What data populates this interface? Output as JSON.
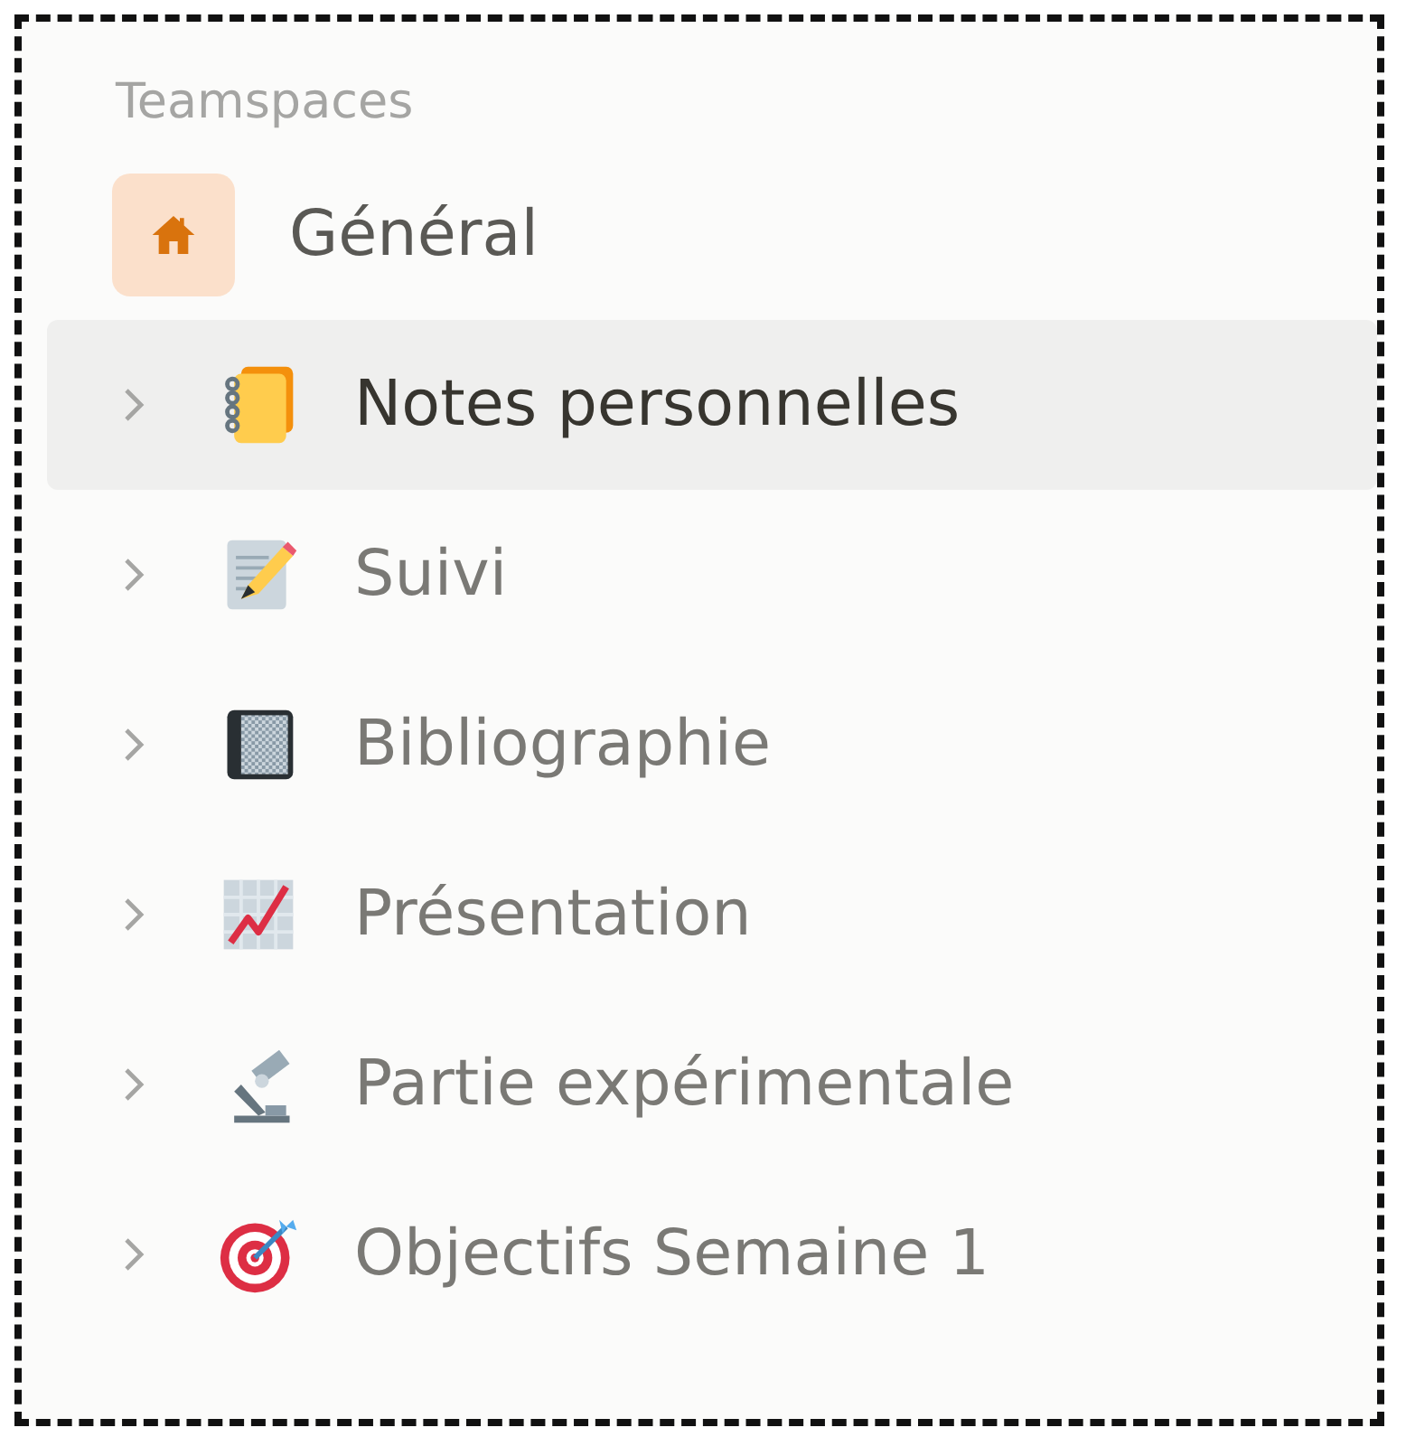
{
  "sidebar": {
    "heading": "Teamspaces",
    "teamspace": {
      "label": "Général"
    },
    "items": [
      {
        "label": "Notes personnelles",
        "selected": true,
        "expanded": false
      },
      {
        "label": "Suivi",
        "selected": false,
        "expanded": false
      },
      {
        "label": "Bibliographie",
        "selected": false,
        "expanded": false
      },
      {
        "label": "Présentation",
        "selected": false,
        "expanded": false
      },
      {
        "label": "Partie expérimentale",
        "selected": false,
        "expanded": false
      },
      {
        "label": "Objectifs Semaine 1",
        "selected": false,
        "expanded": false
      }
    ]
  }
}
